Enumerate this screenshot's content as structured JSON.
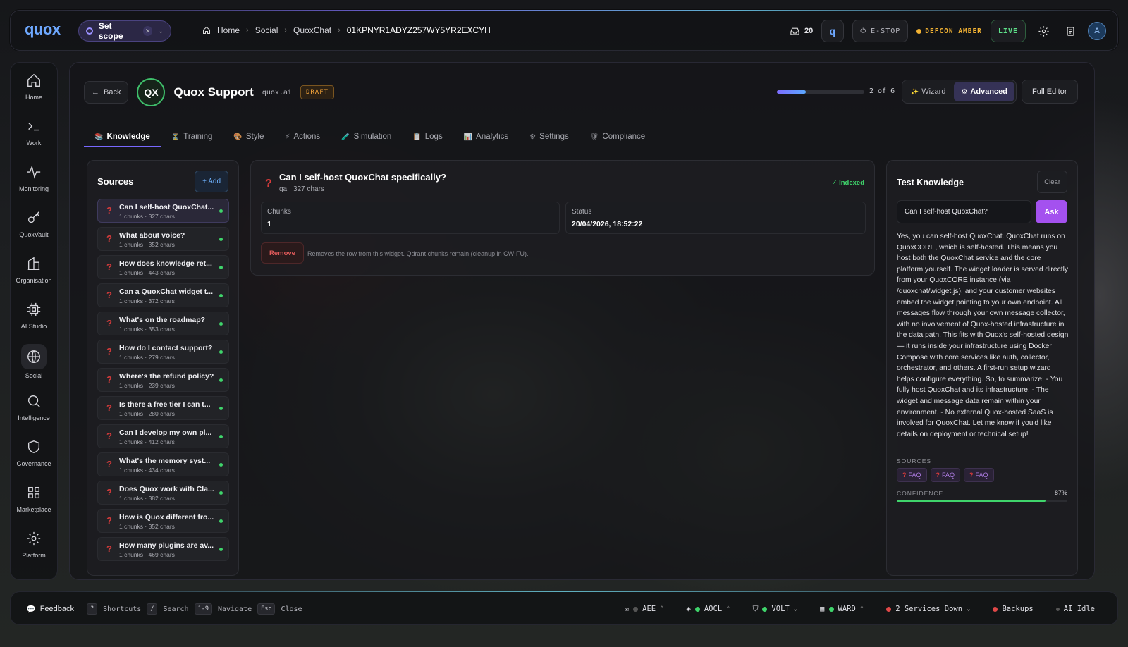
{
  "topbar": {
    "logo": "quox",
    "scope_label": "Set scope",
    "breadcrumbs": [
      "Home",
      "Social",
      "QuoxChat",
      "01KPNYR1ADYZ257WY5YR2EXCYH"
    ],
    "inbox_count": "20",
    "estop": "E-STOP",
    "defcon": "DEFCON AMBER",
    "live": "LIVE",
    "avatar": "A"
  },
  "sidebar": {
    "items": [
      {
        "label": "Home",
        "icon": "home-icon"
      },
      {
        "label": "Work",
        "icon": "terminal-icon"
      },
      {
        "label": "Monitoring",
        "icon": "pulse-icon"
      },
      {
        "label": "QuoxVault",
        "icon": "key-icon"
      },
      {
        "label": "Organisation",
        "icon": "building-icon"
      },
      {
        "label": "AI Studio",
        "icon": "chip-icon"
      },
      {
        "label": "Social",
        "icon": "globe-icon",
        "active": true
      },
      {
        "label": "Intelligence",
        "icon": "search-icon"
      },
      {
        "label": "Governance",
        "icon": "shield-icon"
      },
      {
        "label": "Marketplace",
        "icon": "grid-icon"
      },
      {
        "label": "Platform",
        "icon": "gear-icon"
      }
    ]
  },
  "header": {
    "back": "Back",
    "badge": "QX",
    "title": "Quox Support",
    "domain": "quox.ai",
    "status": "DRAFT",
    "progress": 0.333,
    "step": "2 of 6",
    "mode_wizard": "Wizard",
    "mode_advanced": "Advanced",
    "full_editor": "Full Editor"
  },
  "tabs": [
    "Knowledge",
    "Training",
    "Style",
    "Actions",
    "Simulation",
    "Logs",
    "Analytics",
    "Settings",
    "Compliance"
  ],
  "sources": {
    "title": "Sources",
    "add": "+ Add",
    "items": [
      {
        "title": "Can I self-host QuoxChat...",
        "meta": "1 chunks · 327 chars"
      },
      {
        "title": "What about voice?",
        "meta": "1 chunks · 352 chars"
      },
      {
        "title": "How does knowledge ret...",
        "meta": "1 chunks · 443 chars"
      },
      {
        "title": "Can a QuoxChat widget t...",
        "meta": "1 chunks · 372 chars"
      },
      {
        "title": "What's on the roadmap?",
        "meta": "1 chunks · 353 chars"
      },
      {
        "title": "How do I contact support?",
        "meta": "1 chunks · 279 chars"
      },
      {
        "title": "Where's the refund policy?",
        "meta": "1 chunks · 239 chars"
      },
      {
        "title": "Is there a free tier I can t...",
        "meta": "1 chunks · 280 chars"
      },
      {
        "title": "Can I develop my own pl...",
        "meta": "1 chunks · 412 chars"
      },
      {
        "title": "What's the memory syst...",
        "meta": "1 chunks · 434 chars"
      },
      {
        "title": "Does Quox work with Cla...",
        "meta": "1 chunks · 382 chars"
      },
      {
        "title": "How is Quox different fro...",
        "meta": "1 chunks · 352 chars"
      },
      {
        "title": "How many plugins are av...",
        "meta": "1 chunks · 469 chars"
      }
    ]
  },
  "detail": {
    "title": "Can I self-host QuoxChat specifically?",
    "meta": "qa · 327 chars",
    "indexed": "✓ Indexed",
    "chunks_label": "Chunks",
    "chunks_value": "1",
    "status_label": "Status",
    "status_value": "20/04/2026, 18:52:22",
    "remove": "Remove",
    "remove_note": "Removes the row from this widget. Qdrant chunks remain (cleanup in CW-FU)."
  },
  "test": {
    "title": "Test Knowledge",
    "clear": "Clear",
    "query": "Can I self-host QuoxChat?",
    "ask": "Ask",
    "answer": "Yes, you can self-host QuoxChat. QuoxChat runs on QuoxCORE, which is self-hosted. This means you host both the QuoxChat service and the core platform yourself. The widget loader is served directly from your QuoxCORE instance (via /quoxchat/widget.js), and your customer websites embed the widget pointing to your own endpoint. All messages flow through your own message collector, with no involvement of Quox-hosted infrastructure in the data path. This fits with Quox's self-hosted design — it runs inside your infrastructure using Docker Compose with core services like auth, collector, orchestrator, and others. A first-run setup wizard helps configure everything. So, to summarize: - You fully host QuoxChat and its infrastructure. - The widget and message data remain within your environment. - No external Quox-hosted SaaS is involved for QuoxChat. Let me know if you'd like details on deployment or technical setup!",
    "sources_label": "SOURCES",
    "sources": [
      "FAQ",
      "FAQ",
      "FAQ"
    ],
    "confidence_label": "CONFIDENCE",
    "confidence_pct": "87%",
    "confidence": 0.87
  },
  "bottombar": {
    "feedback": "Feedback",
    "shortcuts": "Shortcuts",
    "search": "Search",
    "navigate": "Navigate",
    "close": "Close",
    "k_shortcuts": "?",
    "k_search": "/",
    "k_navigate": "1-9",
    "k_close": "Esc",
    "services": [
      "AEE",
      "AOCL",
      "VOLT",
      "WARD"
    ],
    "down": "2 Services Down",
    "backups": "Backups",
    "ai": "AI Idle"
  }
}
